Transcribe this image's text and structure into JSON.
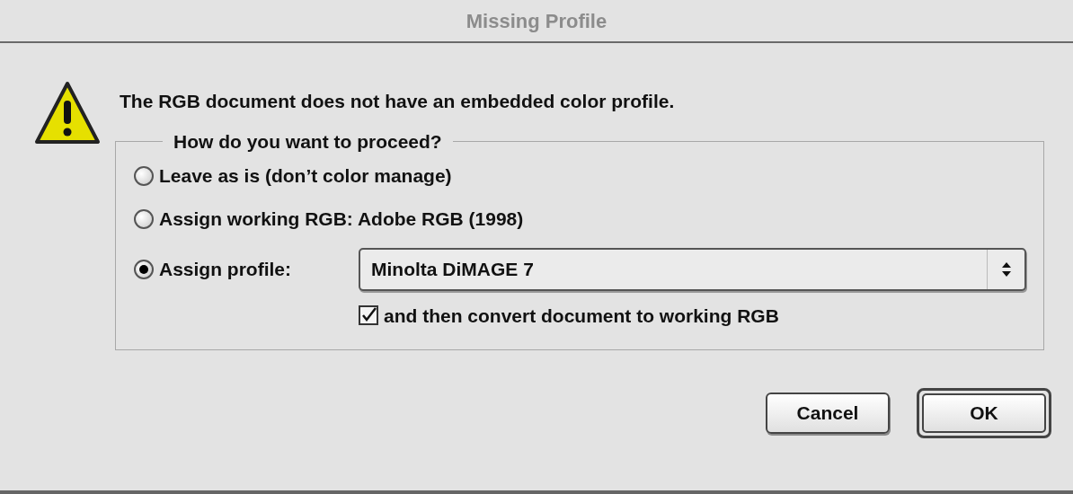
{
  "window": {
    "title": "Missing Profile"
  },
  "message": "The RGB document does not have an embedded color profile.",
  "group": {
    "title": "How do you want to proceed?",
    "options": [
      {
        "kind": "plain",
        "label": "Leave as is (don’t color manage)",
        "selected": false
      },
      {
        "kind": "plain",
        "label": "Assign working RGB:  Adobe RGB (1998)",
        "selected": false
      },
      {
        "kind": "select",
        "label": "Assign profile:",
        "selected": true,
        "value": "Minolta DiMAGE 7"
      }
    ],
    "checkbox": {
      "label": "and then convert document to working RGB",
      "checked": true
    }
  },
  "buttons": [
    {
      "label": "Cancel",
      "default": false
    },
    {
      "label": "OK",
      "default": true
    }
  ]
}
